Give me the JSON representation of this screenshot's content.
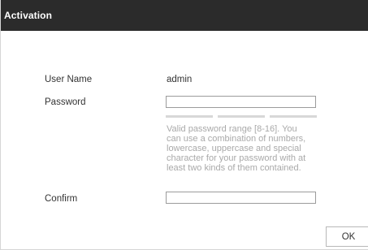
{
  "dialog": {
    "title": "Activation"
  },
  "form": {
    "username": {
      "label": "User Name",
      "value": "admin"
    },
    "password": {
      "label": "Password",
      "value": "",
      "strength_segments": 3,
      "hint_lines": [
        "Valid password range [8-16]. You",
        "can use a combination of numbers,",
        "lowercase, uppercase and special",
        "character for your password with at",
        "least two kinds of them contained."
      ]
    },
    "confirm": {
      "label": "Confirm",
      "value": ""
    }
  },
  "actions": {
    "ok_label": "OK"
  },
  "colors": {
    "titlebar": "#2b2b2b",
    "hint_text": "#a9a9a9",
    "strength_empty": "#d8d8d8"
  }
}
